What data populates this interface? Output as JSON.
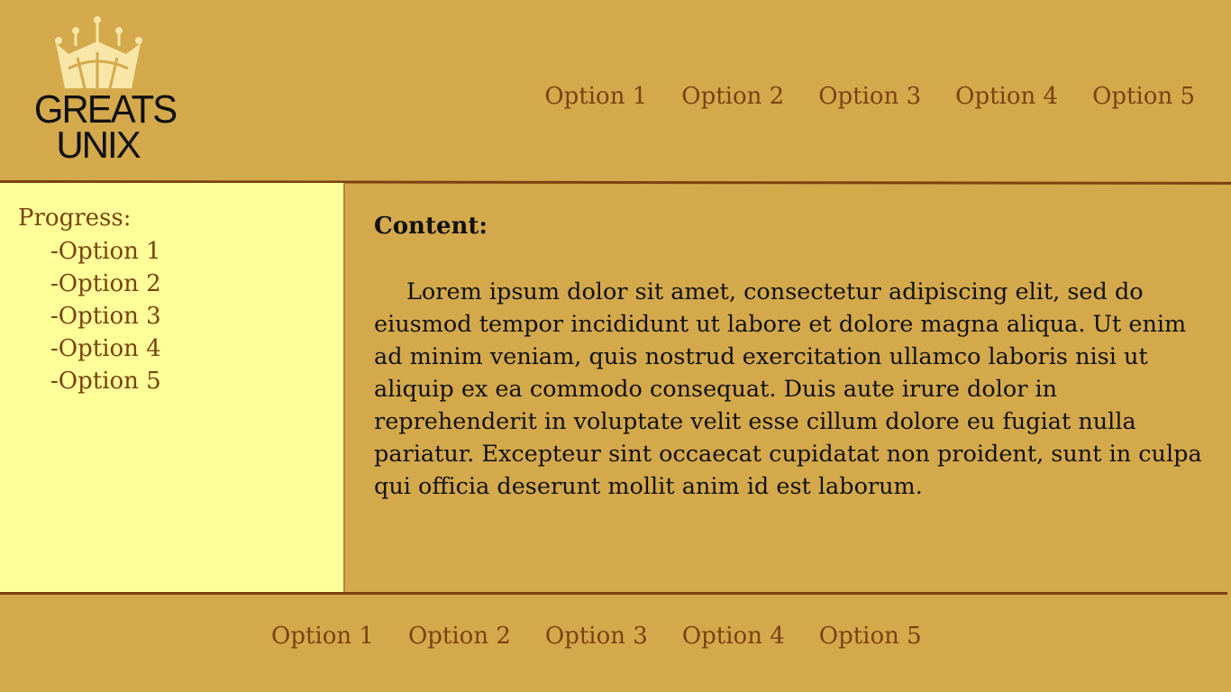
{
  "logo": {
    "line1": "GREATS",
    "line2": "UNIX",
    "icon": "crown-icon",
    "crown_color": "#f7e6a8"
  },
  "top_nav": [
    {
      "label": "Option 1"
    },
    {
      "label": "Option 2"
    },
    {
      "label": "Option 3"
    },
    {
      "label": "Option 4"
    },
    {
      "label": "Option 5"
    }
  ],
  "sidebar": {
    "title": "Progress:",
    "items": [
      {
        "label": "-Option 1"
      },
      {
        "label": "-Option 2"
      },
      {
        "label": "-Option 3"
      },
      {
        "label": "-Option 4"
      },
      {
        "label": "-Option 5"
      }
    ]
  },
  "content": {
    "title": "Content:",
    "body": "Lorem ipsum dolor sit amet, consectetur adipiscing elit, sed do eiusmod tempor incididunt ut labore et dolore magna aliqua. Ut enim ad minim veniam, quis nostrud exercitation ullamco laboris nisi ut aliquip ex ea commodo consequat. Duis aute irure dolor in reprehenderit in voluptate velit esse cillum dolore eu fugiat nulla pariatur. Excepteur sint occaecat cupidatat non proident, sunt in culpa qui officia deserunt mollit anim id est laborum."
  },
  "footer_nav": [
    {
      "label": "Option 1"
    },
    {
      "label": "Option 2"
    },
    {
      "label": "Option 3"
    },
    {
      "label": "Option 4"
    },
    {
      "label": "Option 5"
    }
  ],
  "colors": {
    "background": "#d4a94c",
    "sidebar_background": "#ffff99",
    "link": "#7a4210",
    "rule": "#7a4210",
    "text": "#111111"
  }
}
